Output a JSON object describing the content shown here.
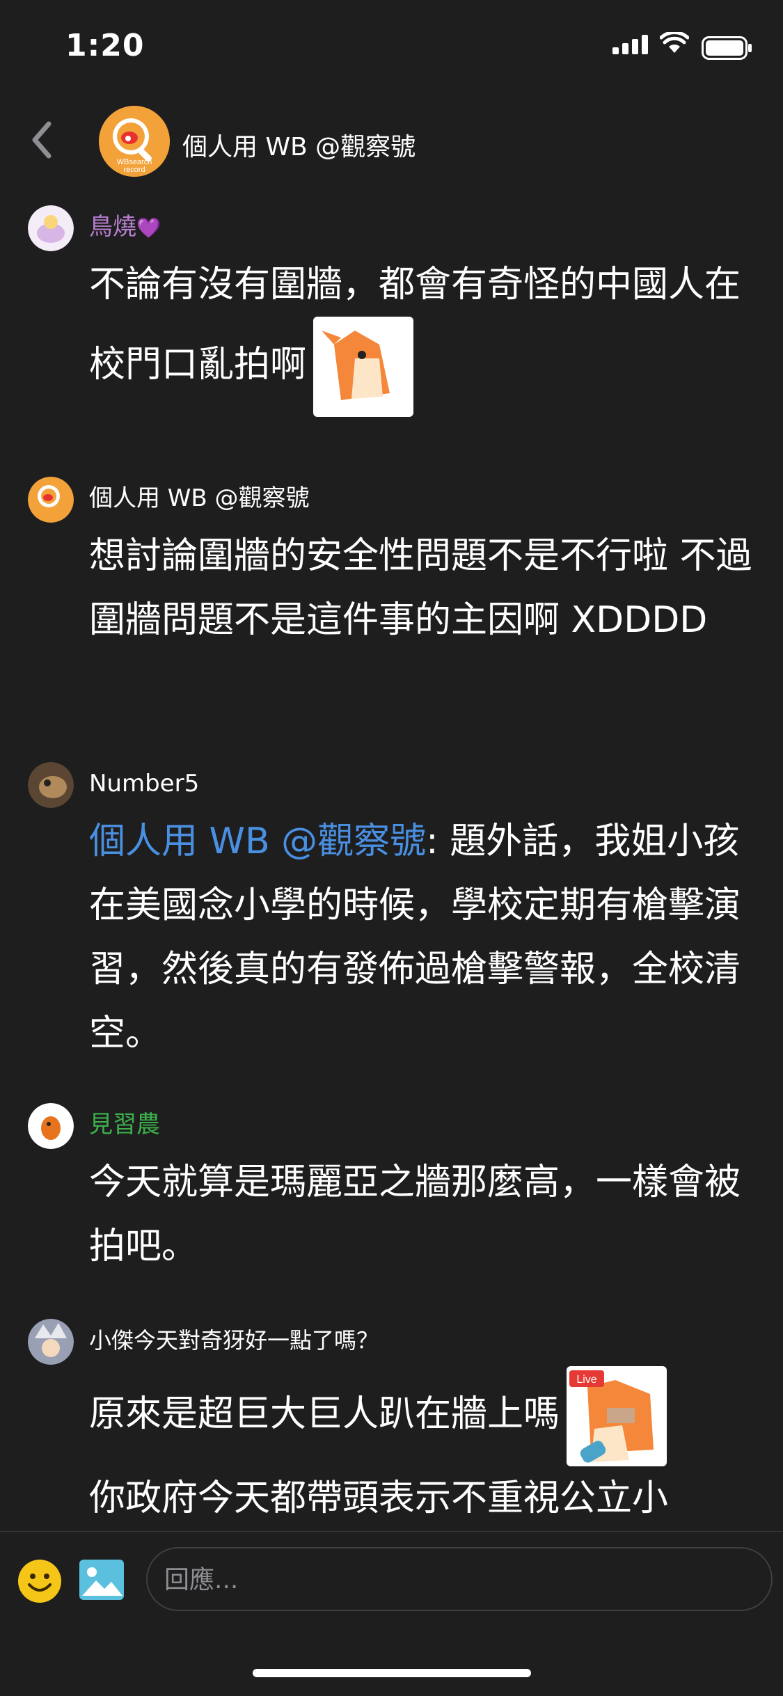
{
  "status_bar": {
    "time": "1:20"
  },
  "header": {
    "back_icon": "chevron-left-icon",
    "title": "個人用 WB @觀察號",
    "logo_text": "WBsearch record"
  },
  "messages": [
    {
      "user": "鳥燒",
      "user_color": "#b77fcf",
      "heart": "💜",
      "text": "不論有沒有圍牆，都會有奇怪的中國人在校門口亂拍啊",
      "sticker": "fox-sticker"
    },
    {
      "user": "個人用 WB @觀察號",
      "user_color": "#ffffff",
      "text": "想討論圍牆的安全性問題不是不行啦 不過圍牆問題不是這件事的主因啊 XDDDD"
    },
    {
      "user": "Number5",
      "user_color": "#ffffff",
      "mention": "個人用 WB @觀察號",
      "text": ": 題外話，我姐小孩在美國念小學的時候，學校定期有槍擊演習，然後真的有發佈過槍擊警報，全校清空。"
    },
    {
      "user": "見習農",
      "user_color": "#3cb04a",
      "text": "今天就算是瑪麗亞之牆那麼高，一樣會被拍吧。"
    },
    {
      "user": "小傑今天對奇犽好一點了嗎？",
      "user_color": "#ffffff",
      "text": "原來是超巨大巨人趴在牆上嗎",
      "sticker": "fox-live-sticker",
      "sticker_label": "Live",
      "text2": "你政府今天都帶頭表示不重視公立小"
    }
  ],
  "composer": {
    "placeholder": "回應..."
  },
  "colors": {
    "background": "#1e1e1f",
    "mention": "#4a90e2",
    "accent": "#f3a23a"
  }
}
